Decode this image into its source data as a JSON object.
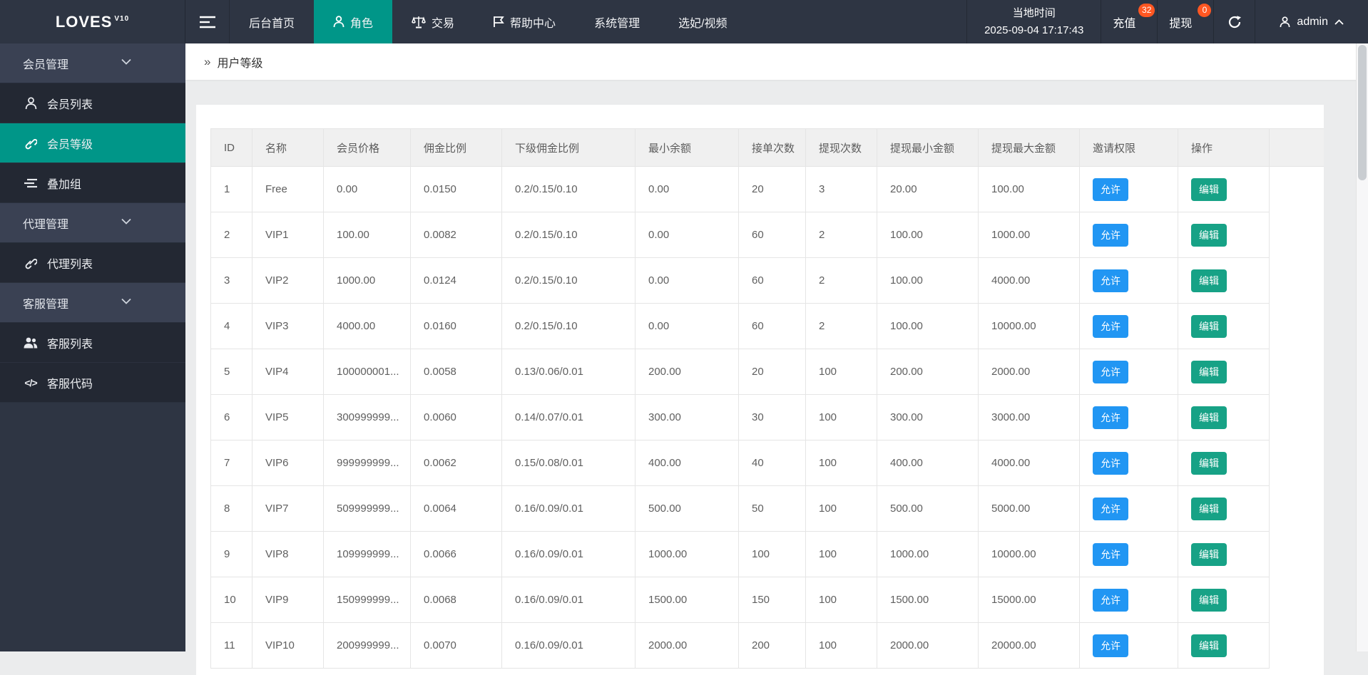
{
  "navbar": {
    "logo": "LOVES",
    "logo_version": "V10",
    "items": [
      {
        "label": "后台首页"
      },
      {
        "label": "角色"
      },
      {
        "label": "交易"
      },
      {
        "label": "帮助中心"
      },
      {
        "label": "系统管理"
      },
      {
        "label": "选妃/视频"
      }
    ],
    "time_label": "当地时间",
    "time_value": "2025-09-04 17:17:43",
    "recharge_label": "充值",
    "recharge_badge": "32",
    "withdraw_label": "提现",
    "withdraw_badge": "0",
    "username": "admin"
  },
  "sidebar": {
    "groups": [
      {
        "label": "会员管理",
        "items": [
          {
            "label": "会员列表"
          },
          {
            "label": "会员等级"
          },
          {
            "label": "叠加组"
          }
        ]
      },
      {
        "label": "代理管理",
        "items": [
          {
            "label": "代理列表"
          }
        ]
      },
      {
        "label": "客服管理",
        "items": [
          {
            "label": "客服列表"
          },
          {
            "label": "客服代码"
          }
        ]
      }
    ]
  },
  "breadcrumb": {
    "label": "用户等级"
  },
  "table": {
    "columns": [
      "ID",
      "名称",
      "会员价格",
      "佣金比例",
      "下级佣金比例",
      "最小余额",
      "接单次数",
      "提现次数",
      "提现最小金额",
      "提现最大金额",
      "邀请权限",
      "操作"
    ],
    "invite_label": "允许",
    "edit_label": "编辑",
    "rows": [
      [
        "1",
        "Free",
        "0.00",
        "0.0150",
        "0.2/0.15/0.10",
        "0.00",
        "20",
        "3",
        "20.00",
        "100.00"
      ],
      [
        "2",
        "VIP1",
        "100.00",
        "0.0082",
        "0.2/0.15/0.10",
        "0.00",
        "60",
        "2",
        "100.00",
        "1000.00"
      ],
      [
        "3",
        "VIP2",
        "1000.00",
        "0.0124",
        "0.2/0.15/0.10",
        "0.00",
        "60",
        "2",
        "100.00",
        "4000.00"
      ],
      [
        "4",
        "VIP3",
        "4000.00",
        "0.0160",
        "0.2/0.15/0.10",
        "0.00",
        "60",
        "2",
        "100.00",
        "10000.00"
      ],
      [
        "5",
        "VIP4",
        "100000001...",
        "0.0058",
        "0.13/0.06/0.01",
        "200.00",
        "20",
        "100",
        "200.00",
        "2000.00"
      ],
      [
        "6",
        "VIP5",
        "300999999...",
        "0.0060",
        "0.14/0.07/0.01",
        "300.00",
        "30",
        "100",
        "300.00",
        "3000.00"
      ],
      [
        "7",
        "VIP6",
        "999999999...",
        "0.0062",
        "0.15/0.08/0.01",
        "400.00",
        "40",
        "100",
        "400.00",
        "4000.00"
      ],
      [
        "8",
        "VIP7",
        "509999999...",
        "0.0064",
        "0.16/0.09/0.01",
        "500.00",
        "50",
        "100",
        "500.00",
        "5000.00"
      ],
      [
        "9",
        "VIP8",
        "109999999...",
        "0.0066",
        "0.16/0.09/0.01",
        "1000.00",
        "100",
        "100",
        "1000.00",
        "10000.00"
      ],
      [
        "10",
        "VIP9",
        "150999999...",
        "0.0068",
        "0.16/0.09/0.01",
        "1500.00",
        "150",
        "100",
        "1500.00",
        "15000.00"
      ],
      [
        "11",
        "VIP10",
        "200999999...",
        "0.0070",
        "0.16/0.09/0.01",
        "2000.00",
        "200",
        "100",
        "2000.00",
        "20000.00"
      ]
    ]
  },
  "colors": {
    "accent_teal": "#009688",
    "navbar_bg": "#2e3543",
    "sidebar_item_bg": "#232833",
    "sidebar_group_bg": "#3a4153",
    "notification_badge": "#ff5722",
    "invite_badge": "#2196f3",
    "edit_button": "#17a286"
  }
}
